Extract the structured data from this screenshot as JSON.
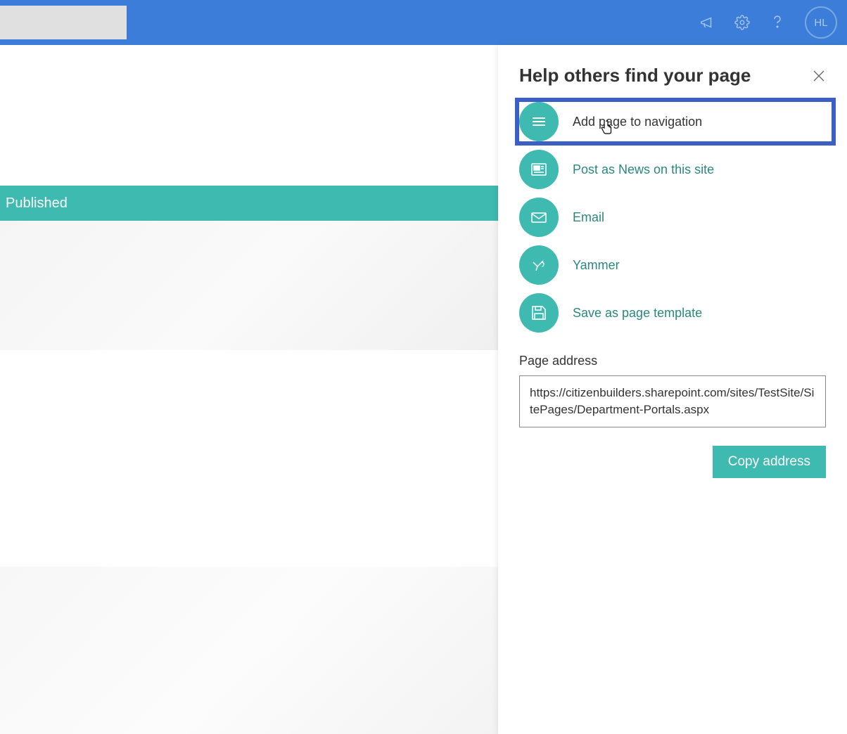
{
  "header": {
    "avatar_initials": "HL"
  },
  "status": {
    "text": "Published"
  },
  "panel": {
    "title": "Help others find your page",
    "options": [
      {
        "key": "add-to-nav",
        "label": "Add page to navigation",
        "icon": "hamburger-icon",
        "highlighted": true
      },
      {
        "key": "post-news",
        "label": "Post as News on this site",
        "icon": "news-icon",
        "highlighted": false
      },
      {
        "key": "email",
        "label": "Email",
        "icon": "mail-icon",
        "highlighted": false
      },
      {
        "key": "yammer",
        "label": "Yammer",
        "icon": "yammer-icon",
        "highlighted": false
      },
      {
        "key": "save-template",
        "label": "Save as page template",
        "icon": "save-icon",
        "highlighted": false
      }
    ],
    "address_label": "Page address",
    "address_value": "https://citizenbuilders.sharepoint.com/sites/TestSite/SitePages/Department-Portals.aspx",
    "copy_button": "Copy address"
  },
  "colors": {
    "primary_blue": "#3b7dd8",
    "teal": "#3fbab0",
    "highlight_border": "#3b5fc7"
  }
}
